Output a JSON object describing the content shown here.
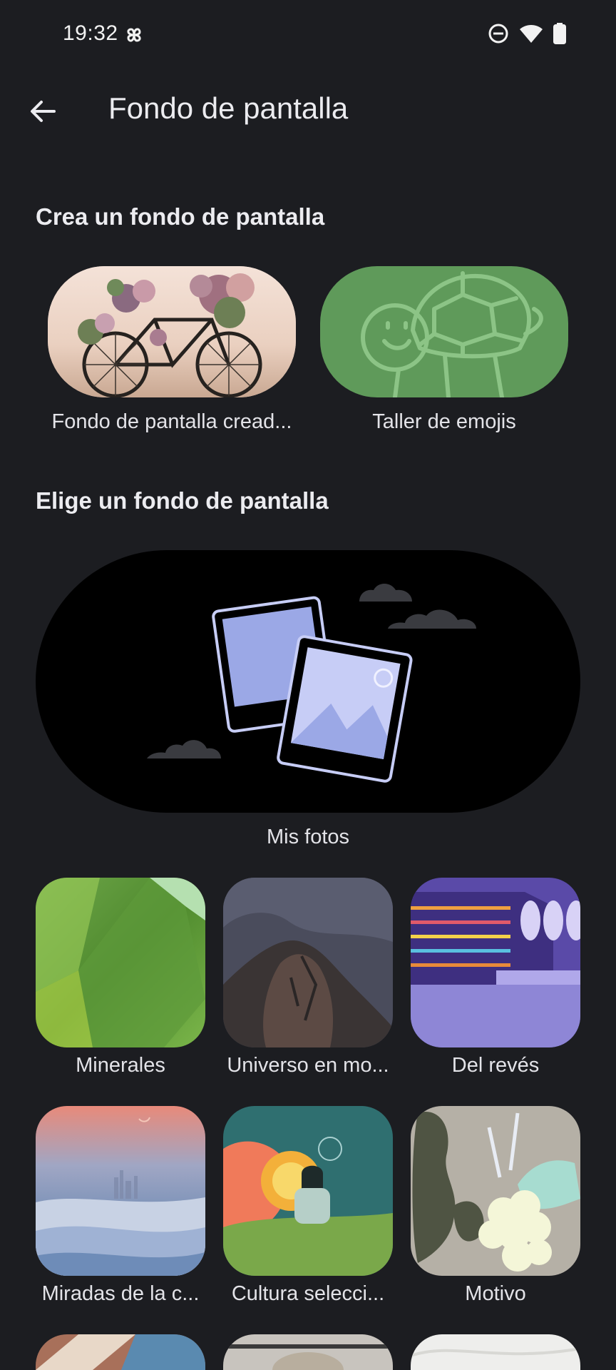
{
  "status_bar": {
    "time": "19:32",
    "icons": [
      "pinwheel-icon",
      "do-not-disturb-icon",
      "wifi-icon",
      "battery-icon"
    ]
  },
  "app_bar": {
    "back_icon": "arrow-back-icon",
    "title": "Fondo de pantalla"
  },
  "create_section": {
    "title": "Crea un fondo de pantalla",
    "items": [
      {
        "label": "Fondo de pantalla cread..."
      },
      {
        "label": "Taller de emojis"
      }
    ]
  },
  "choose_section": {
    "title": "Elige un fondo de pantalla",
    "my_photos": {
      "label": "Mis fotos"
    },
    "categories": [
      {
        "label": "Minerales"
      },
      {
        "label": "Universo en mo..."
      },
      {
        "label": "Del revés"
      },
      {
        "label": "Miradas de la c..."
      },
      {
        "label": "Cultura selecci..."
      },
      {
        "label": "Motivo"
      }
    ]
  },
  "colors": {
    "background": "#1c1d21",
    "emoji_card": "#5f9a5a",
    "photos_accent": "#9ba8e6"
  }
}
